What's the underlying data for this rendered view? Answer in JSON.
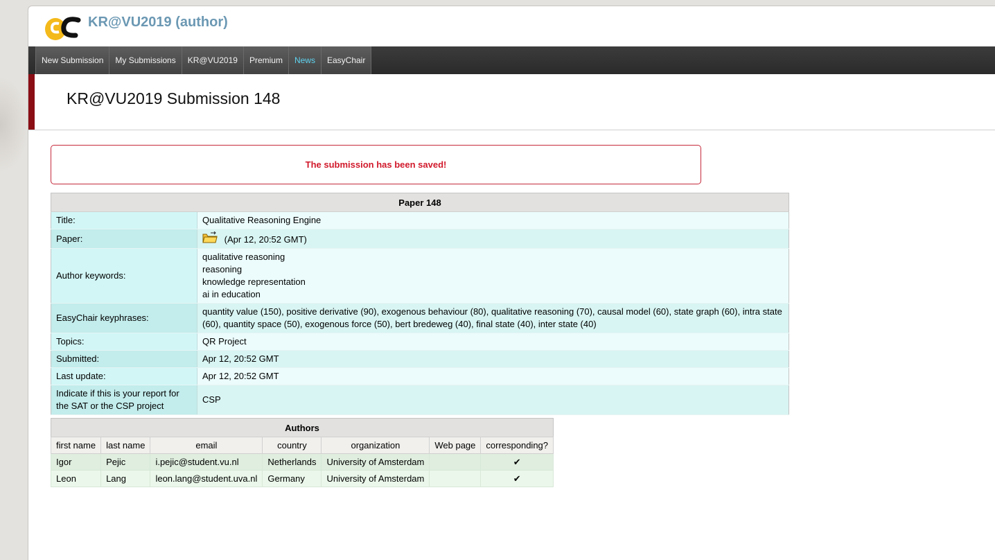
{
  "app": {
    "title": "KR@VU2019 (author)"
  },
  "nav": {
    "items": [
      {
        "label": "New Submission"
      },
      {
        "label": "My Submissions"
      },
      {
        "label": "KR@VU2019"
      },
      {
        "label": "Premium"
      },
      {
        "label": "News",
        "highlighted": true
      },
      {
        "label": "EasyChair"
      }
    ]
  },
  "page": {
    "title": "KR@VU2019 Submission 148"
  },
  "message": {
    "text": "The submission has been saved!",
    "color": "#d1192b"
  },
  "paper": {
    "caption": "Paper 148",
    "rows": {
      "title": {
        "label": "Title:",
        "value": "Qualitative Reasoning Engine"
      },
      "paper": {
        "label": "Paper:",
        "value": "(Apr 12, 20:52 GMT)",
        "icon": "folder-icon"
      },
      "keywords": {
        "label": "Author keywords:",
        "values": [
          "qualitative reasoning",
          "reasoning",
          "knowledge representation",
          "ai in education"
        ]
      },
      "keyphrases": {
        "label": "EasyChair keyphrases:",
        "value": "quantity value (150), positive derivative (90), exogenous behaviour (80), qualitative reasoning (70), causal model (60), state graph (60), intra state (60), quantity space (50), exogenous force (50), bert bredeweg (40), final state (40), inter state (40)"
      },
      "topics": {
        "label": "Topics:",
        "value": "QR Project"
      },
      "submitted": {
        "label": "Submitted:",
        "value": "Apr 12, 20:52 GMT"
      },
      "last_update": {
        "label": "Last update:",
        "value": "Apr 12, 20:52 GMT"
      },
      "report": {
        "label": "Indicate if this is your report for the SAT or the CSP project",
        "value": "CSP"
      }
    }
  },
  "authors": {
    "caption": "Authors",
    "columns": [
      "first name",
      "last name",
      "email",
      "country",
      "organization",
      "Web page",
      "corresponding?"
    ],
    "rows": [
      {
        "first": "Igor",
        "last": "Pejic",
        "email": "i.pejic@student.vu.nl",
        "country": "Netherlands",
        "org": "University of Amsterdam",
        "web": "",
        "corresponding": "✔"
      },
      {
        "first": "Leon",
        "last": "Lang",
        "email": "leon.lang@student.uva.nl",
        "country": "Germany",
        "org": "University of Amsterdam",
        "web": "",
        "corresponding": "✔"
      }
    ]
  }
}
